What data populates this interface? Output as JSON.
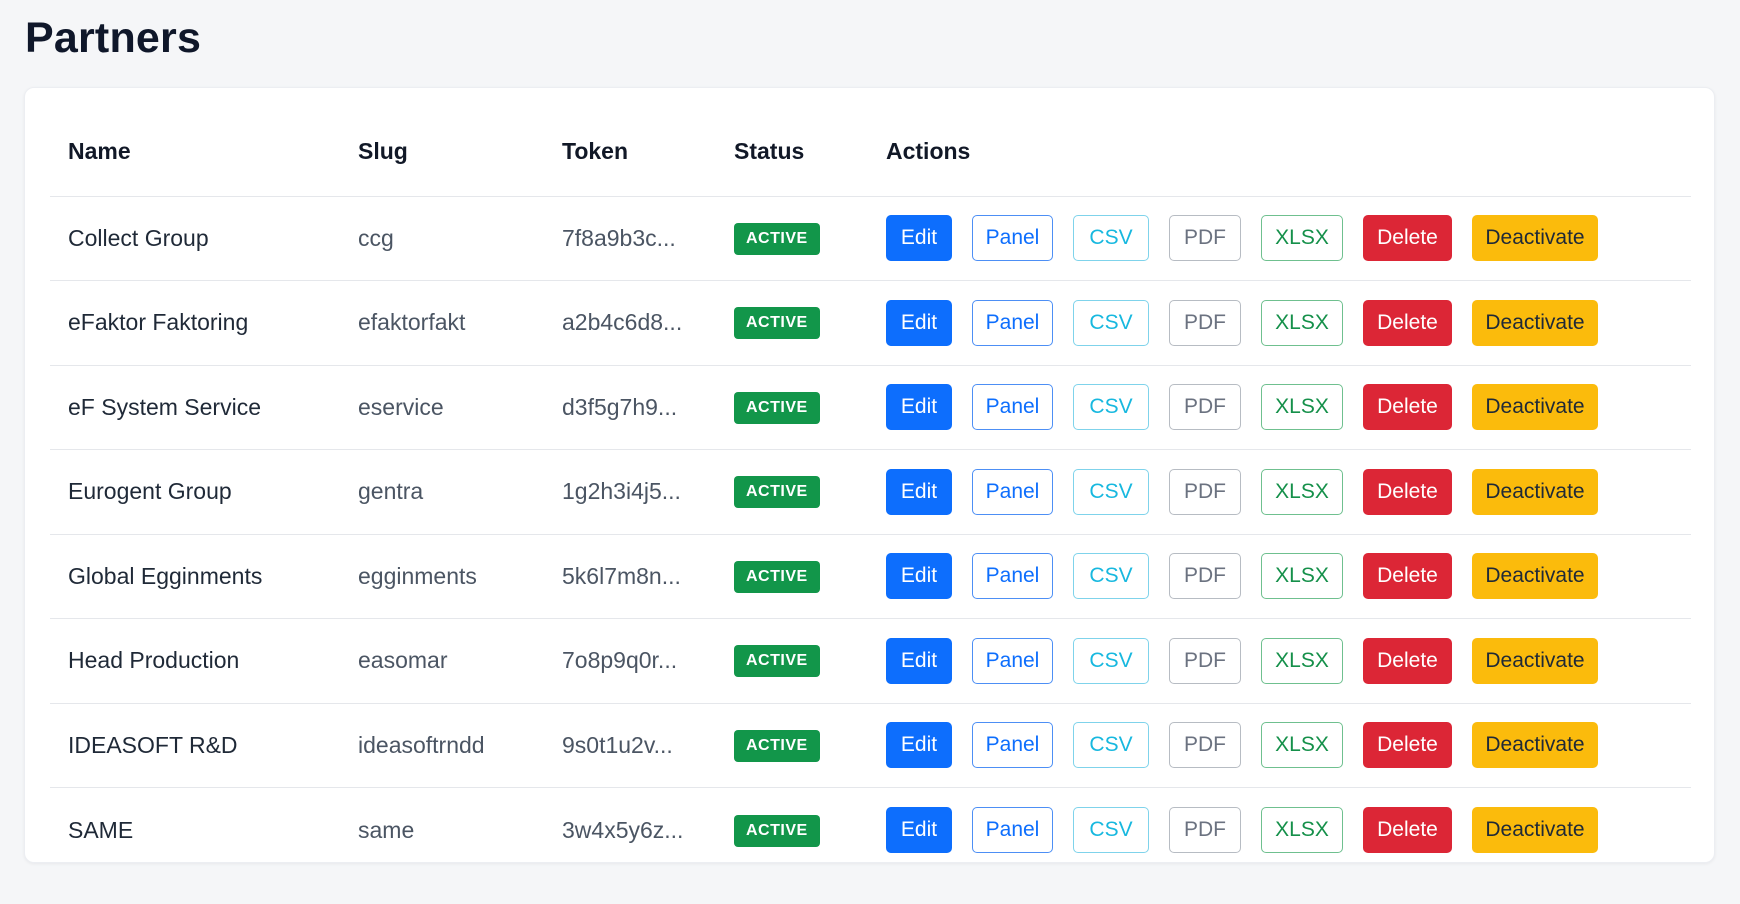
{
  "page": {
    "title": "Partners"
  },
  "table": {
    "columns": [
      "Name",
      "Slug",
      "Token",
      "Status",
      "Actions"
    ],
    "action_labels": {
      "edit": "Edit",
      "panel": "Panel",
      "csv": "CSV",
      "pdf": "PDF",
      "xlsx": "XLSX",
      "delete": "Delete",
      "deactivate": "Deactivate"
    },
    "rows": [
      {
        "name": "Collect Group",
        "slug": "ccg",
        "token": "7f8a9b3c...",
        "status": "ACTIVE"
      },
      {
        "name": "eFaktor Faktoring",
        "slug": "efaktorfakt",
        "token": "a2b4c6d8...",
        "status": "ACTIVE"
      },
      {
        "name": "eF System Service",
        "slug": "eservice",
        "token": "d3f5g7h9...",
        "status": "ACTIVE"
      },
      {
        "name": "Eurogent Group",
        "slug": "gentra",
        "token": "1g2h3i4j5...",
        "status": "ACTIVE"
      },
      {
        "name": "Global Egginments",
        "slug": "egginments",
        "token": "5k6l7m8n...",
        "status": "ACTIVE"
      },
      {
        "name": "Head Production",
        "slug": "easomar",
        "token": "7o8p9q0r...",
        "status": "ACTIVE"
      },
      {
        "name": "IDEASOFT R&D",
        "slug": "ideasoftrndd",
        "token": "9s0t1u2v...",
        "status": "ACTIVE"
      },
      {
        "name": "SAME",
        "slug": "same",
        "token": "3w4x5y6z...",
        "status": "ACTIVE"
      }
    ]
  },
  "colors": {
    "background": "#f5f6f8",
    "card": "#ffffff",
    "primary": "#0d6efd",
    "info": "#17b8df",
    "secondary": "#6b7280",
    "success": "#15904a",
    "danger": "#dc2636",
    "warning": "#fbbb0c",
    "badge_active": "#12964a"
  }
}
